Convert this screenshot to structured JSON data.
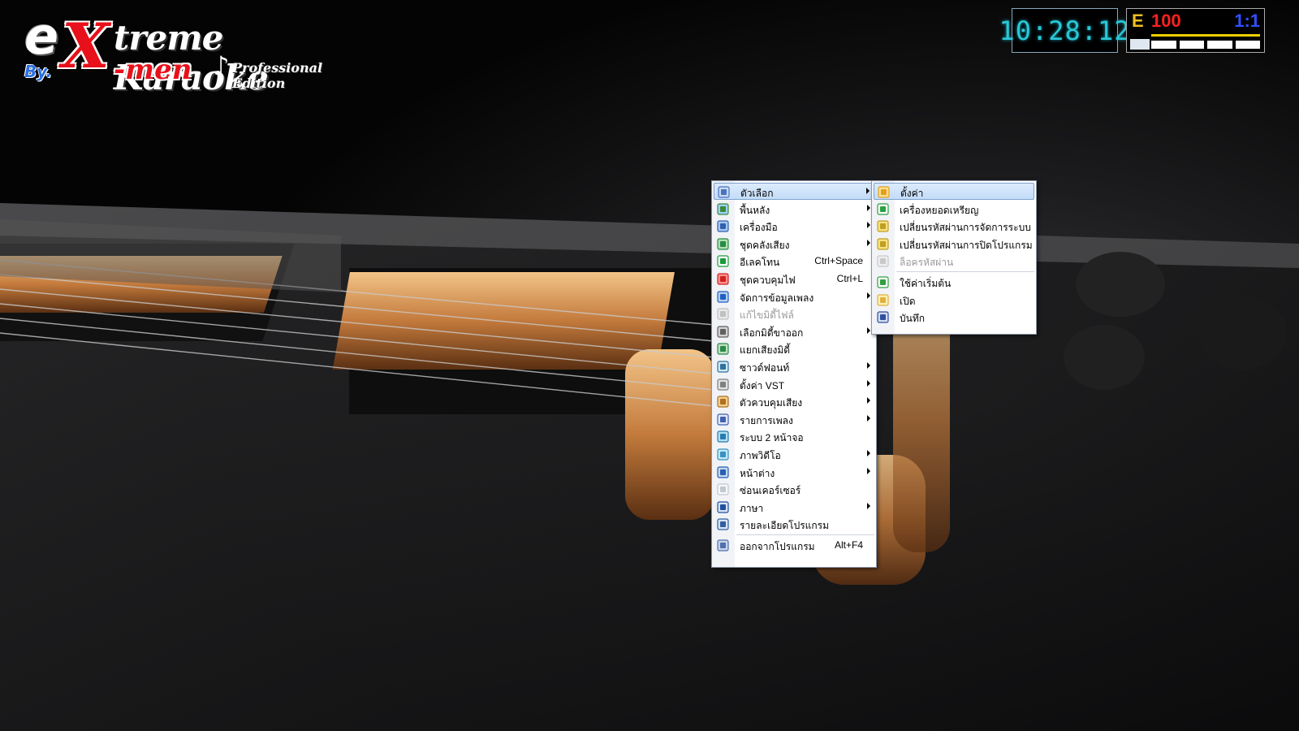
{
  "logo": {
    "e": "e",
    "x": "X",
    "treme": "treme Karaoke",
    "by": "By.",
    "men": "-men",
    "note": "♪",
    "edition": "Professional Edition"
  },
  "clock": {
    "time": "10:28:12"
  },
  "status": {
    "e_label": "E",
    "volume": "100",
    "ratio": "1:1"
  },
  "main_menu": [
    {
      "label": "ตัวเลือก",
      "icon": "options-icon",
      "submenu": true,
      "highlighted": true
    },
    {
      "label": "พื้นหลัง",
      "icon": "background-icon",
      "submenu": true
    },
    {
      "label": "เครื่องมือ",
      "icon": "tools-icon",
      "submenu": true
    },
    {
      "label": "ชุดคลังเสียง",
      "icon": "soundbank-icon",
      "submenu": true
    },
    {
      "label": "อีเลคโทน",
      "icon": "music-note-icon",
      "shortcut": "Ctrl+Space"
    },
    {
      "label": "ชุดควบคุมไฟ",
      "icon": "light-control-icon",
      "shortcut": "Ctrl+L"
    },
    {
      "label": "จัดการข้อมูลเพลง",
      "icon": "song-data-icon",
      "submenu": true
    },
    {
      "label": "แก้ไขมิดี้ไฟล์",
      "icon": "midi-edit-icon",
      "disabled": true
    },
    {
      "label": "เลือกมิดี้ขาออก",
      "icon": "midi-out-icon",
      "submenu": true
    },
    {
      "label": "แยกเสียงมิดี้",
      "icon": "midi-split-icon"
    },
    {
      "label": "ซาวด์ฟอนท์",
      "icon": "soundfont-icon",
      "submenu": true
    },
    {
      "label": "ตั้งค่า VST",
      "icon": "vst-icon",
      "submenu": true
    },
    {
      "label": "ตัวควบคุมเสียง",
      "icon": "speaker-icon",
      "submenu": true
    },
    {
      "label": "รายการเพลง",
      "icon": "playlist-icon",
      "submenu": true
    },
    {
      "label": "ระบบ 2 หน้าจอ",
      "icon": "dual-monitor-icon"
    },
    {
      "label": "ภาพวิดีโอ",
      "icon": "video-icon",
      "submenu": true
    },
    {
      "label": "หน้าต่าง",
      "icon": "window-icon",
      "submenu": true
    },
    {
      "label": "ซ่อนเคอร์เซอร์",
      "icon": "hide-cursor-icon"
    },
    {
      "label": "ภาษา",
      "icon": "language-icon",
      "submenu": true
    },
    {
      "label": "รายละเอียดโปรแกรม",
      "icon": "about-icon"
    },
    {
      "label": "ออกจากโปรแกรม",
      "icon": "exit-icon",
      "shortcut": "Alt+F4",
      "separator_before": true
    }
  ],
  "sub_menu": [
    {
      "label": "ตั้งค่า",
      "icon": "settings-hand-icon",
      "highlighted": true
    },
    {
      "label": "เครื่องหยอดเหรียญ",
      "icon": "coin-icon"
    },
    {
      "label": "เปลี่ยนรหัสผ่านการจัดการระบบ",
      "icon": "key-icon"
    },
    {
      "label": "เปลี่ยนรหัสผ่านการปิดโปรแกรม",
      "icon": "key-icon"
    },
    {
      "label": "ล็อครหัสผ่าน",
      "icon": "lock-icon",
      "disabled": true
    },
    {
      "label": "ใช้ค่าเริ่มต้น",
      "icon": "home-icon",
      "separator_before": true
    },
    {
      "label": "เปิด",
      "icon": "folder-open-icon"
    },
    {
      "label": "บันทึก",
      "icon": "save-icon"
    }
  ],
  "colors": {
    "highlight": "#c3dcf8",
    "clock_digits": "#29c8d8",
    "volume": "#ff2020",
    "ratio": "#3050ff",
    "logo_red": "#e8101a"
  }
}
